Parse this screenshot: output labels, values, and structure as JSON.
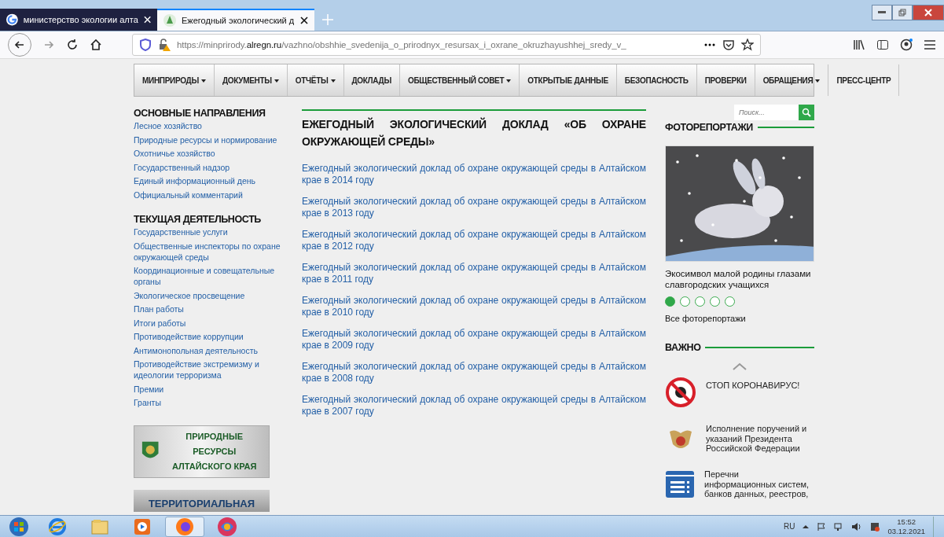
{
  "browser": {
    "tabs": [
      {
        "title": "министерство экологии алта",
        "kind": "google",
        "selected": false
      },
      {
        "title": "Ежегодный экологический д",
        "kind": "site",
        "selected": true
      }
    ],
    "url": {
      "prefix": "https://minprirody.",
      "domain": "alregn.ru",
      "path": "/vazhno/obshhie_svedenija_o_prirodnyx_resursax_i_oxrane_okruzhayushhej_sredy_v_"
    }
  },
  "nav": [
    {
      "label": "МИНПРИРОДЫ",
      "has_menu": true
    },
    {
      "label": "ДОКУМЕНТЫ",
      "has_menu": true
    },
    {
      "label": "ОТЧЁТЫ",
      "has_menu": true
    },
    {
      "label": "ДОКЛАДЫ",
      "has_menu": false
    },
    {
      "label": "ОБЩЕСТВЕННЫЙ СОВЕТ",
      "has_menu": true
    },
    {
      "label": "ОТКРЫТЫЕ ДАННЫЕ",
      "has_menu": false
    },
    {
      "label": "БЕЗОПАСНОСТЬ",
      "has_menu": false
    },
    {
      "label": "ПРОВЕРКИ",
      "has_menu": false
    },
    {
      "label": "ОБРАЩЕНИЯ",
      "has_menu": true
    },
    {
      "label": "ПРЕСС-ЦЕНТР",
      "has_menu": false
    }
  ],
  "sidebar": {
    "sections": [
      {
        "title": "ОСНОВНЫЕ НАПРАВЛЕНИЯ",
        "items": [
          "Лесное хозяйство",
          "Природные ресурсы и нормирование",
          "Охотничье хозяйство",
          "Государственный надзор",
          "Единый информационный день",
          "Официальный комментарий"
        ]
      },
      {
        "title": "ТЕКУЩАЯ ДЕЯТЕЛЬНОСТЬ",
        "items": [
          "Государственные услуги",
          "Общественные инспекторы по охране окружающей среды",
          "Координационные и совещательные органы",
          "Экологическое просвещение",
          "План работы",
          "Итоги работы",
          "Противодействие коррупции",
          "Антимонопольная деятельность",
          "Противодействие экстремизму и идеологии терроризма",
          "Премии",
          "Гранты"
        ]
      }
    ],
    "banners": [
      {
        "lines": [
          "ПРИРОДНЫЕ РЕСУРСЫ",
          "АЛТАЙСКОГО КРАЯ"
        ]
      },
      {
        "lines": [
          "ТЕРРИТОРИАЛЬНАЯ"
        ]
      }
    ]
  },
  "main": {
    "title": "ЕЖЕГОДНЫЙ ЭКОЛОГИЧЕСКИЙ ДОКЛАД «ОБ ОХРАНЕ ОКРУЖАЮЩЕЙ СРЕДЫ»",
    "links": [
      "Ежегодный экологический доклад об охране окружающей среды в Алтайском крае в 2014 году",
      "Ежегодный экологический доклад об охране окружающей среды в Алтайском крае в 2013 году",
      "Ежегодный экологический доклад об охране окружающей среды в Алтайском крае в 2012 году",
      "Ежегодный экологический доклад об охране окружающей среды в Алтайском крае в 2011 году",
      "Ежегодный экологический доклад об охране окружающей среды в Алтайском крае в 2010 году",
      "Ежегодный экологический доклад об охране окружающей среды в Алтайском крае в 2009 году",
      "Ежегодный экологический доклад об охране окружающей среды в Алтайском крае в 2008 году",
      "Ежегодный экологический доклад об охране окружающей среды в Алтайском крае в 2007 году"
    ]
  },
  "right": {
    "search": {
      "placeholder": "Поиск..."
    },
    "photos": {
      "title": "ФОТОРЕПОРТАЖИ",
      "caption": "Экосимвол малой родины глазами славгородских учащихся",
      "dots": [
        {
          "selected": true
        },
        {
          "selected": false
        },
        {
          "selected": false
        },
        {
          "selected": false
        },
        {
          "selected": false
        }
      ],
      "all_link": "Все фоторепортажи"
    },
    "important": {
      "title": "ВАЖНО",
      "items": [
        {
          "kind": "covid",
          "text": "СТОП КОРОНАВИРУС!"
        },
        {
          "kind": "emblem",
          "text": "Исполнение поручений и указаний Президента Российской Федерации"
        },
        {
          "kind": "list",
          "text": "Перечни информационных систем, банков данных, реестров,"
        }
      ]
    }
  },
  "taskbar": {
    "apps": [
      {
        "kind": "ie",
        "selected": false
      },
      {
        "kind": "explorer",
        "selected": false
      },
      {
        "kind": "media",
        "selected": false
      },
      {
        "kind": "firefox",
        "selected": true
      },
      {
        "kind": "other",
        "selected": false
      }
    ],
    "language": "RU",
    "time": "15:52",
    "date": "03.12.2021"
  }
}
